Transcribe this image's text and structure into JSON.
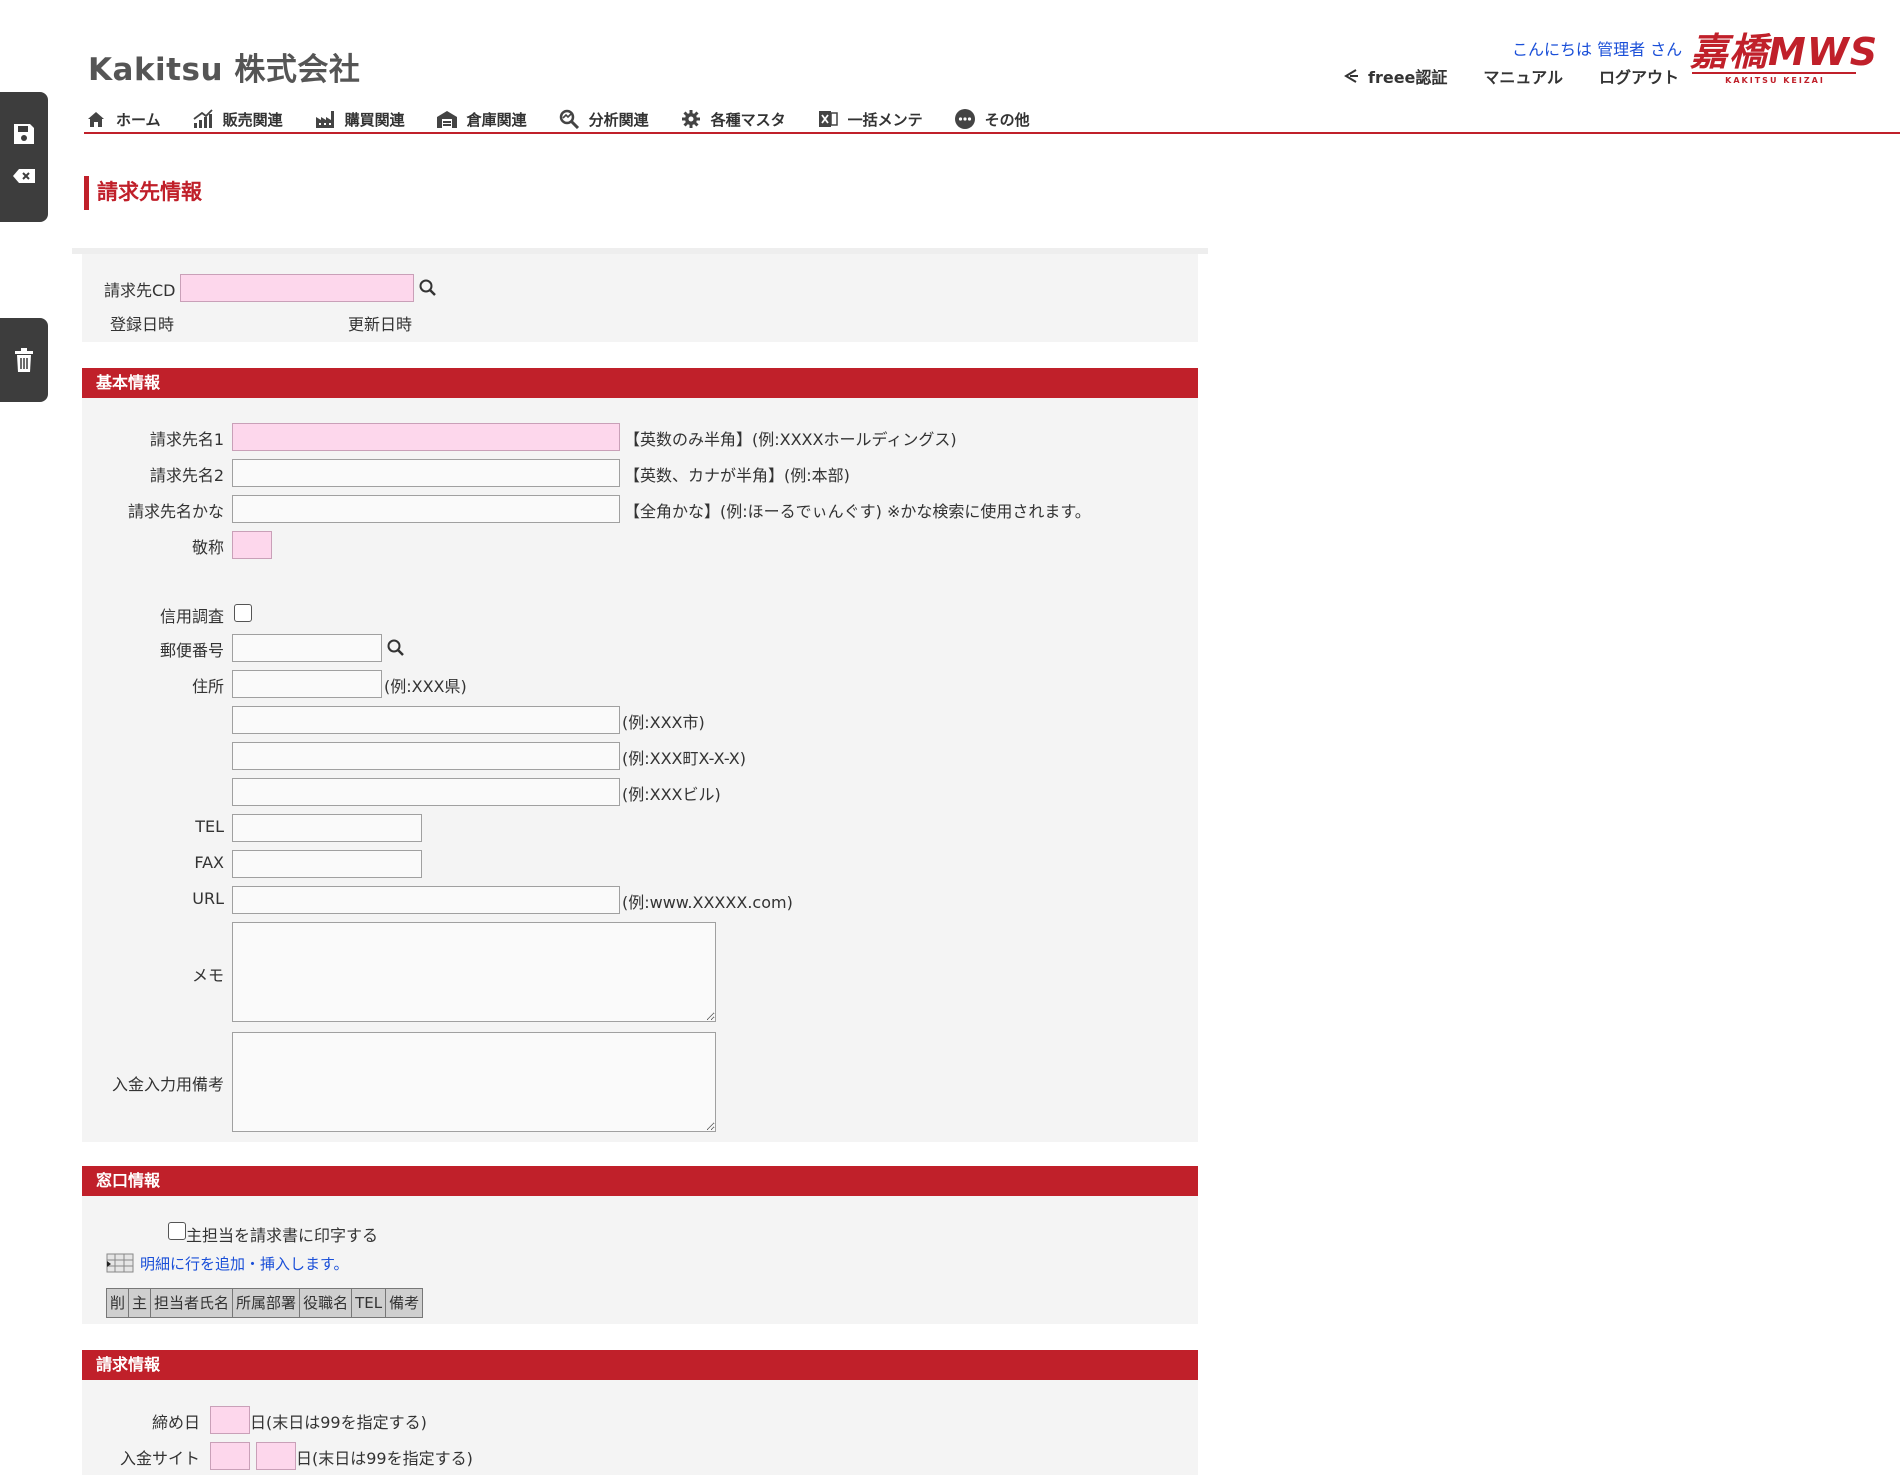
{
  "header": {
    "company": "Kakitsu 株式会社",
    "greeting": "こんにちは 管理者 さん",
    "brand_main": "嘉橋MWS",
    "brand_sub": "KAKITSU KEIZAI",
    "links": {
      "freee": "freee認証",
      "manual": "マニュアル",
      "logout": "ログアウト"
    }
  },
  "nav": {
    "home": "ホーム",
    "sales": "販売関連",
    "purchase": "購買関連",
    "warehouse": "倉庫関連",
    "analysis": "分析関連",
    "master": "各種マスタ",
    "bulk": "一括メンテ",
    "other": "その他"
  },
  "page_title": "請求先情報",
  "top_form": {
    "cd_label": "請求先CD",
    "created_label": "登録日時",
    "updated_label": "更新日時"
  },
  "basic": {
    "heading": "基本情報",
    "name1_label": "請求先名1",
    "name1_hint": "【英数のみ半角】(例:XXXXホールディングス)",
    "name2_label": "請求先名2",
    "name2_hint": "【英数、カナが半角】(例:本部)",
    "kana_label": "請求先名かな",
    "kana_hint": "【全角かな】(例:ほーるでぃんぐす) ※かな検索に使用されます。",
    "honorific_label": "敬称",
    "credit_label": "信用調査",
    "zip_label": "郵便番号",
    "address_label": "住所",
    "addr1_hint": "(例:XXX県)",
    "addr2_hint": "(例:XXX市)",
    "addr3_hint": "(例:XXX町X-X-X)",
    "addr4_hint": "(例:XXXビル)",
    "tel_label": "TEL",
    "fax_label": "FAX",
    "url_label": "URL",
    "url_hint": "(例:www.XXXXX.com)",
    "memo_label": "メモ",
    "payment_note_label": "入金入力用備考"
  },
  "contact": {
    "heading": "窓口情報",
    "print_main_label": "主担当を請求書に印字する",
    "add_row_text": "明細に行を追加・挿入します。",
    "columns": [
      "削",
      "主",
      "担当者氏名",
      "所属部署",
      "役職名",
      "TEL",
      "備考"
    ]
  },
  "billing": {
    "heading": "請求情報",
    "closing_label": "締め日",
    "closing_hint": "日(末日は99を指定する)",
    "payment_site_label": "入金サイト",
    "payment_site_hint": "日(末日は99を指定する)"
  },
  "colors": {
    "accent": "#c0202a",
    "required_field": "#fdd7ec",
    "link": "#1a4fd8",
    "panel": "#f4f4f4"
  }
}
